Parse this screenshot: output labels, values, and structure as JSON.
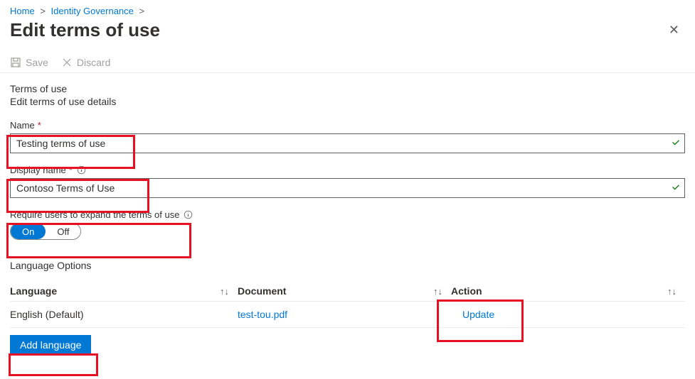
{
  "breadcrumb": {
    "items": [
      "Home",
      "Identity Governance"
    ]
  },
  "header": {
    "title": "Edit terms of use"
  },
  "toolbar": {
    "save_label": "Save",
    "discard_label": "Discard"
  },
  "section": {
    "title": "Terms of use",
    "subtitle": "Edit terms of use details"
  },
  "fields": {
    "name": {
      "label": "Name",
      "value": "Testing terms of use"
    },
    "display_name": {
      "label": "Display name",
      "value": "Contoso Terms of Use"
    },
    "require_expand": {
      "label": "Require users to expand the terms of use",
      "on": "On",
      "off": "Off"
    }
  },
  "lang": {
    "section_title": "Language Options",
    "headers": {
      "language": "Language",
      "document": "Document",
      "action": "Action"
    },
    "rows": [
      {
        "language": "English (Default)",
        "document": "test-tou.pdf",
        "action": "Update"
      }
    ],
    "add_btn": "Add language"
  }
}
